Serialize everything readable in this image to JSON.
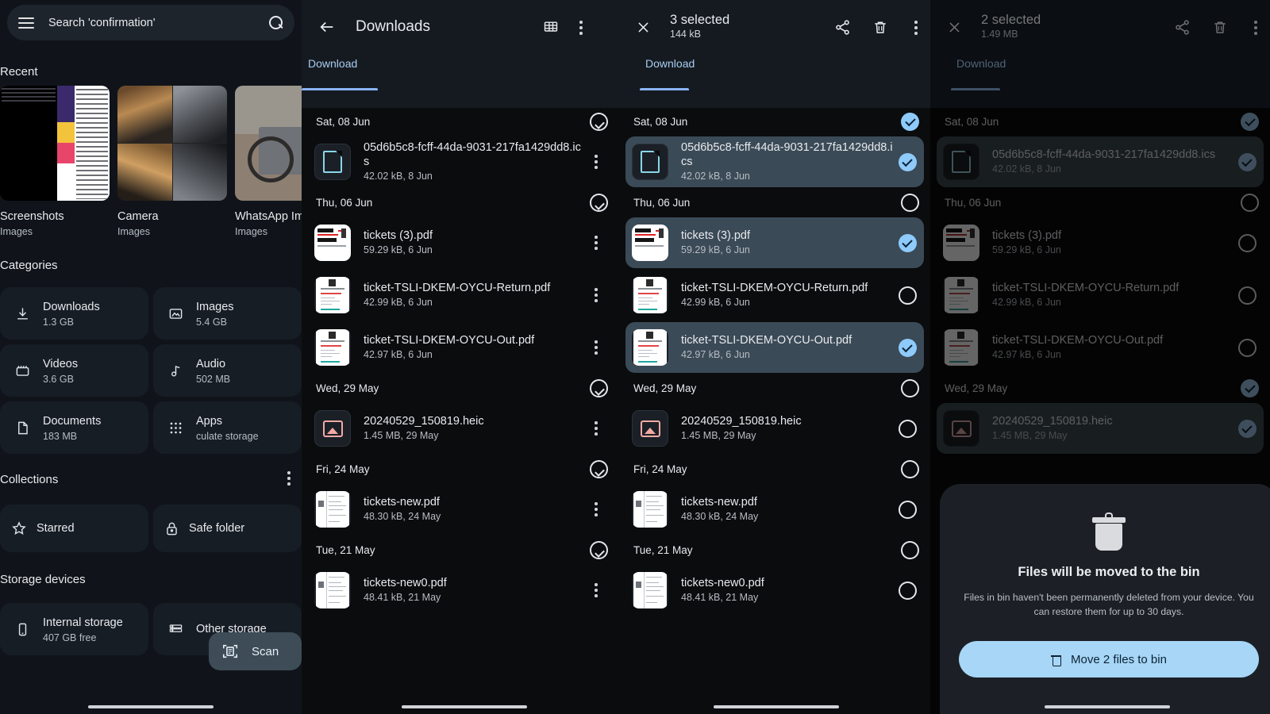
{
  "home": {
    "search": {
      "placeholder": "Search 'confirmation'",
      "icon": "search-icon",
      "menu_icon": "hamburger-icon"
    },
    "recent": {
      "title": "Recent",
      "items": [
        {
          "name": "Screenshots",
          "sub": "Images"
        },
        {
          "name": "Camera",
          "sub": "Images"
        },
        {
          "name": "WhatsApp Images",
          "sub": "Images"
        }
      ]
    },
    "categories": {
      "title": "Categories",
      "items": [
        {
          "label": "Downloads",
          "size": "1.3 GB",
          "icon": "download-icon"
        },
        {
          "label": "Images",
          "size": "5.4 GB",
          "icon": "image-icon"
        },
        {
          "label": "Videos",
          "size": "3.6 GB",
          "icon": "video-icon"
        },
        {
          "label": "Audio",
          "size": "502 MB",
          "icon": "music-note-icon"
        },
        {
          "label": "Documents",
          "size": "183 MB",
          "icon": "document-icon"
        },
        {
          "label": "Apps",
          "size": "culate storage",
          "icon": "apps-grid-icon"
        }
      ]
    },
    "collections": {
      "title": "Collections",
      "menu_icon": "kebab-icon",
      "items": [
        {
          "label": "Starred",
          "icon": "star-icon"
        },
        {
          "label": "Safe folder",
          "icon": "lock-icon"
        }
      ]
    },
    "storage": {
      "title": "Storage devices",
      "items": [
        {
          "label": "Internal storage",
          "size": "407 GB free",
          "icon": "phone-icon"
        },
        {
          "label": "Other storage",
          "size": "",
          "icon": "drives-icon"
        }
      ]
    },
    "scan_fab": {
      "label": "Scan",
      "icon": "scan-document-icon"
    }
  },
  "browse": {
    "title": "Downloads",
    "back_icon": "back-arrow-icon",
    "grid_icon": "grid-view-icon",
    "overflow_icon": "kebab-icon",
    "tab": "Download"
  },
  "select3": {
    "count_label": "3 selected",
    "size_label": "144 kB",
    "close_icon": "close-icon",
    "share_icon": "share-icon",
    "delete_icon": "trash-icon",
    "overflow_icon": "kebab-icon",
    "tab": "Download"
  },
  "select2": {
    "count_label": "2 selected",
    "size_label": "1.49 MB",
    "close_icon": "close-icon",
    "share_icon": "share-icon",
    "delete_icon": "trash-icon",
    "overflow_icon": "kebab-icon",
    "tab": "Download"
  },
  "bin_dialog": {
    "icon": "trash-bin-icon",
    "title": "Files will be moved to the bin",
    "description": "Files in bin haven't been permanently deleted from your device. You can restore them for up to 30 days.",
    "button_label": "Move 2 files to bin",
    "button_icon": "trash-icon",
    "button_color": "#a7d6f7"
  },
  "groups": [
    {
      "date": "Sat, 08 Jun",
      "files": [
        {
          "name": "05d6b5c8-fcff-44da-9031-217fa1429dd8.ics",
          "meta": "42.02 kB, 8 Jun",
          "thumb": "ics-file-icon"
        }
      ]
    },
    {
      "date": "Thu, 06 Jun",
      "files": [
        {
          "name": "tickets (3).pdf",
          "meta": "59.29 kB, 6 Jun",
          "thumb": "pdf-ticket-thumb"
        },
        {
          "name": "ticket-TSLI-DKEM-OYCU-Return.pdf",
          "meta": "42.99 kB, 6 Jun",
          "thumb": "pdf-form-thumb"
        },
        {
          "name": "ticket-TSLI-DKEM-OYCU-Out.pdf",
          "meta": "42.97 kB, 6 Jun",
          "thumb": "pdf-form-thumb"
        }
      ]
    },
    {
      "date": "Wed, 29 May",
      "files": [
        {
          "name": "20240529_150819.heic",
          "meta": "1.45 MB, 29 May",
          "thumb": "image-file-icon"
        }
      ]
    },
    {
      "date": "Fri, 24 May",
      "files": [
        {
          "name": "tickets-new.pdf",
          "meta": "48.30 kB, 24 May",
          "thumb": "pdf-lines-thumb"
        }
      ]
    },
    {
      "date": "Tue, 21 May",
      "files": [
        {
          "name": "tickets-new0.pdf",
          "meta": "48.41 kB, 21 May",
          "thumb": "pdf-lines-thumb"
        }
      ]
    }
  ],
  "colors": {
    "accent": "#8ab4f8",
    "checked": "#8ecafa",
    "selected_row": "#3b4a57",
    "surface": "#151a21",
    "background": "#0b0c0e"
  }
}
